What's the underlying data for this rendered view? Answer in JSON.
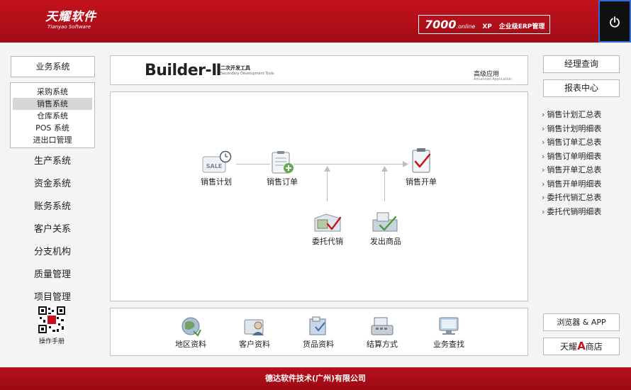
{
  "header": {
    "logo_cn": "天耀软件",
    "logo_en": "Tianyao Software",
    "product_num": "7000",
    "product_sub": ".online",
    "product_xp": "XP",
    "product_edition": "企业级ERP管理"
  },
  "left_nav": {
    "business_system": "业务系统",
    "sub_items": [
      "采购系统",
      "销售系统",
      "仓库系统",
      "POS 系统",
      "进出口管理"
    ],
    "active_sub": "销售系统",
    "items": [
      "生产系统",
      "资金系统",
      "账务系统",
      "客户关系",
      "分支机构",
      "质量管理",
      "项目管理"
    ],
    "manual_label": "操作手册"
  },
  "banner": {
    "brand": "Builder-Ⅱ",
    "brand_cn": "二次开发工具",
    "brand_en": "Secondary Development Tools",
    "advanced_cn": "高级应用",
    "advanced_en": "Advanced Application"
  },
  "flow": {
    "sales_plan": "销售计划",
    "sales_order": "销售订单",
    "sales_invoice": "销售开单",
    "consignment": "委托代销",
    "shipment": "发出商品",
    "sale_icon_text": "SALE"
  },
  "bottom": {
    "region": "地区资料",
    "customer": "客户资料",
    "goods": "货品资料",
    "settlement": "结算方式",
    "business_query": "业务查找"
  },
  "right": {
    "manager_query": "经理查询",
    "report_center": "报表中心",
    "reports": [
      "销售计划汇总表",
      "销售计划明细表",
      "销售订单汇总表",
      "销售订单明细表",
      "销售开单汇总表",
      "销售开单明细表",
      "委托代销汇总表",
      "委托代销明细表"
    ],
    "browser_app": "浏览器 & APP",
    "store_prefix": "天耀",
    "store_a": "A",
    "store_suffix": "商店"
  },
  "footer": {
    "company": "德达软件技术(广州)有限公司"
  },
  "colors": {
    "brand_red": "#b30f1a",
    "power_border": "#2f6bd9",
    "store_a": "#c8101c"
  }
}
